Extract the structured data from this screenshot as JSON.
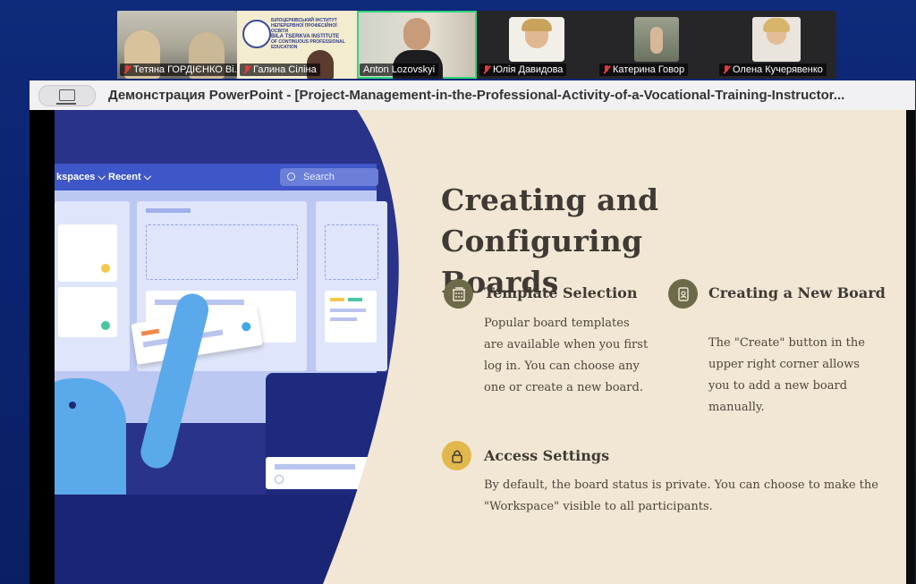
{
  "participants": [
    {
      "name": "Тетяна ГОРДІЄНКО Ві...",
      "muted": true,
      "active": false
    },
    {
      "name": "Галина Сіліна",
      "muted": true,
      "active": false,
      "logo_lines": [
        "БІЛОЦЕРКІВСЬКИЙ ІНСТИТУТ",
        "НЕПЕРЕРВНОЇ ПРОФЕСІЙНОЇ ОСВІТИ",
        "BILA TSERKVA INSTITUTE",
        "OF CONTINUOUS PROFESSIONAL",
        "EDUCATION"
      ]
    },
    {
      "name": "Anton Lozovskyi",
      "muted": false,
      "active": true
    },
    {
      "name": "Юлія Давидова",
      "muted": true,
      "active": false
    },
    {
      "name": "Катерина Говор",
      "muted": true,
      "active": false
    },
    {
      "name": "Олена Кучерявенко",
      "muted": true,
      "active": false
    }
  ],
  "share": {
    "title": "Демонстрация PowerPoint - [Project-Management-in-the-Professional-Activity-of-a-Vocational-Training-Instructor..."
  },
  "illustration": {
    "nav_workspaces": "kspaces",
    "nav_recent": "Recent",
    "search_label": "Search"
  },
  "slide": {
    "title_line1": "Creating and Configuring",
    "title_line2": "Boards",
    "features": {
      "template": {
        "heading": "Template Selection",
        "lines": [
          "Popular board templates",
          "are available when you first",
          "log in. You can choose any",
          "one or create a new board."
        ]
      },
      "new_board": {
        "heading": "Creating a New Board",
        "lines": [
          "The \"Create\" button in the",
          "upper right corner allows",
          "you to add a new board",
          "manually."
        ]
      },
      "access": {
        "heading": "Access Settings",
        "lines": [
          "By default, the board status is private. You can choose to make the",
          "\"Workspace\" visible to all participants."
        ]
      }
    }
  },
  "colors": {
    "background": "#0f2a7a",
    "slide_cream": "#f1e7d4",
    "illustration_blue": "#283389",
    "icon_olive": "#6d6a4a",
    "icon_gold": "#e2b84c",
    "active_speaker": "#2fd57a"
  },
  "icons": {
    "template": "building-icon",
    "new_board": "contact-card-icon",
    "access": "padlock-icon"
  }
}
